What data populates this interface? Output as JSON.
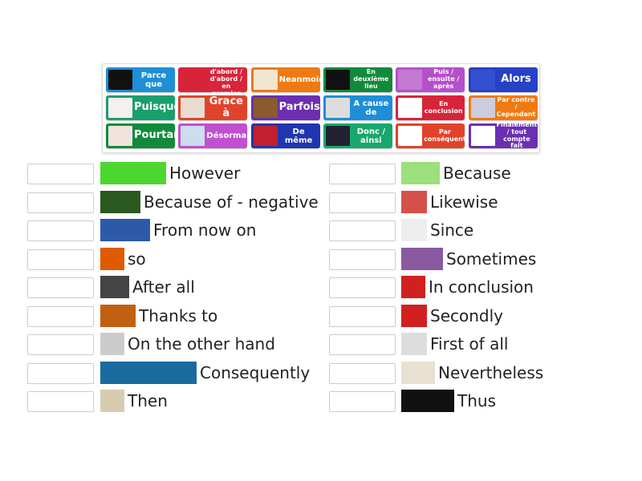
{
  "tiles": [
    {
      "label": "Parce que",
      "color": "#1e8fd6",
      "size": "m",
      "img": "#111"
    },
    {
      "label": "Tout d'abord / d'abord / en premier",
      "color": "#d8243a",
      "size": "s",
      "img": "#d8243a"
    },
    {
      "label": "Neanmoins",
      "color": "#ef7a12",
      "size": "m",
      "img": "#f3e6cf"
    },
    {
      "label": "En deuxième lieu",
      "color": "#128a3c",
      "size": "s",
      "img": "#111"
    },
    {
      "label": "Puis / ensuite / après",
      "color": "#b54fcb",
      "size": "s",
      "img": "#c27ad3"
    },
    {
      "label": "Alors",
      "color": "#2541c6",
      "size": "l",
      "img": "#3450d0"
    },
    {
      "label": "Puisque",
      "color": "#18a06c",
      "size": "l",
      "img": "#f4f0ee"
    },
    {
      "label": "Grace à",
      "color": "#e1432a",
      "size": "l",
      "img": "#e8ddd0"
    },
    {
      "label": "Parfois",
      "color": "#6b2fb1",
      "size": "l",
      "img": "#8a5a30"
    },
    {
      "label": "A cause de",
      "color": "#1e8fd6",
      "size": "m",
      "img": "#ddd"
    },
    {
      "label": "En conclusion",
      "color": "#d8243a",
      "size": "s",
      "img": "#fff"
    },
    {
      "label": "Par contre / Cependant",
      "color": "#ef7a12",
      "size": "s",
      "img": "#ccd"
    },
    {
      "label": "Pourtant",
      "color": "#128a3c",
      "size": "l",
      "img": "#f1e4de"
    },
    {
      "label": "Désormais",
      "color": "#c050d0",
      "size": "m",
      "img": "#cde"
    },
    {
      "label": "De même",
      "color": "#2035b0",
      "size": "m",
      "img": "#c02030"
    },
    {
      "label": "Donc / ainsi",
      "color": "#18a86e",
      "size": "m",
      "img": "#223"
    },
    {
      "label": "Par conséquent",
      "color": "#e1432a",
      "size": "s",
      "img": "#fff"
    },
    {
      "label": "Finalement / tout compte fait",
      "color": "#6b2fb1",
      "size": "s",
      "img": "#fff"
    }
  ],
  "left": [
    {
      "text": "However",
      "img": "however",
      "imgColor": "#4cd630",
      "w": 82
    },
    {
      "text": "Because of - negative",
      "img": "because-sign",
      "imgColor": "#2a5a20",
      "w": 50
    },
    {
      "text": "From now on",
      "img": "here-and-now",
      "imgColor": "#2c5aa8",
      "w": 62
    },
    {
      "text": "so",
      "img": "so",
      "imgColor": "#e05a00",
      "w": 30
    },
    {
      "text": "After all",
      "img": "after-all",
      "imgColor": "#444",
      "w": 36
    },
    {
      "text": "Thanks to",
      "img": "thanks",
      "imgColor": "#c06010",
      "w": 44
    },
    {
      "text": "On the other hand",
      "img": "hand",
      "imgColor": "#ccc",
      "w": 30
    },
    {
      "text": "Consequently",
      "img": "therefore-quote",
      "imgColor": "#1a6aa0",
      "w": 120
    },
    {
      "text": "Then",
      "img": "then",
      "imgColor": "#d8ccb0",
      "w": 30
    }
  ],
  "right": [
    {
      "text": "Because",
      "img": "because",
      "imgColor": "#9be07a",
      "w": 48
    },
    {
      "text": "Likewise",
      "img": "likewise",
      "imgColor": "#d6504a",
      "w": 32
    },
    {
      "text": "Since",
      "img": "since-1998",
      "imgColor": "#eee",
      "w": 32
    },
    {
      "text": "Sometimes",
      "img": "sometimes",
      "imgColor": "#8a5aa0",
      "w": 52
    },
    {
      "text": "In conclusion",
      "img": "in-conclusion",
      "imgColor": "#d02020",
      "w": 30
    },
    {
      "text": "Secondly",
      "img": "medal",
      "imgColor": "#d02020",
      "w": 32
    },
    {
      "text": "First of all",
      "img": "first-of-all",
      "imgColor": "#ddd",
      "w": 32
    },
    {
      "text": "Nevertheless",
      "img": "nevertheless",
      "imgColor": "#e8e0d0",
      "w": 42
    },
    {
      "text": "Thus",
      "img": "thus",
      "imgColor": "#111",
      "w": 66
    }
  ]
}
